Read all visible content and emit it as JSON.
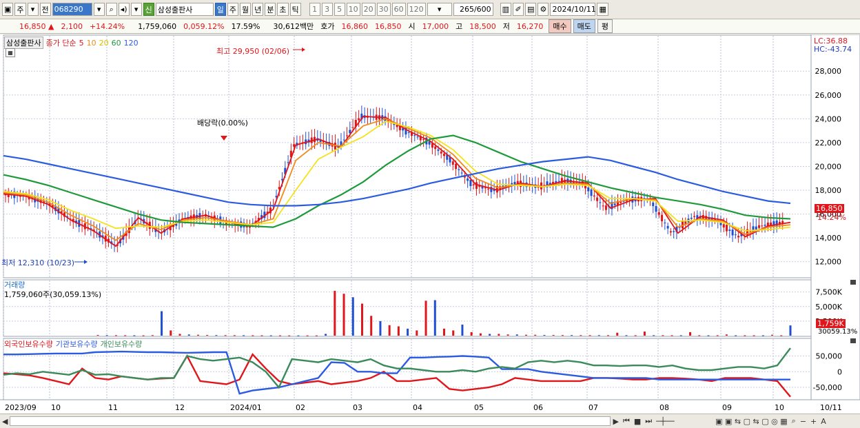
{
  "toolbar": {
    "mode": "주",
    "prev_label": "전",
    "code": "068290",
    "shin_label": "신",
    "stock_name": "삼성출판사",
    "periods": [
      "일",
      "주",
      "월",
      "년",
      "분",
      "초",
      "틱"
    ],
    "selected_period": "일",
    "intervals": [
      "1",
      "3",
      "5",
      "10",
      "20",
      "30",
      "60",
      "120"
    ],
    "count": "265/600",
    "date": "2024/10/11"
  },
  "quote": {
    "price": "16,850",
    "change": "2,100",
    "change_pct": "+14.24%",
    "volume": "1,759,060",
    "volume_pct": "0,059.12%",
    "turnover": "17.59%",
    "amount": "30,612백만",
    "hoga_label": "호가",
    "ask": "16,860",
    "bid": "16,850",
    "open_label": "시",
    "open": "17,000",
    "high_label": "고",
    "high": "18,500",
    "low_label": "저",
    "low": "16,270",
    "buy_label": "매수",
    "sell_label": "매도",
    "flat_label": "평"
  },
  "price_panel": {
    "name_tag": "삼성출판사",
    "legend_prefix": "종가 단순",
    "ma_labels": [
      "5",
      "10",
      "20",
      "60",
      "120"
    ],
    "lc_label": "LC:36.88",
    "hc_label": "HC:-43.74",
    "current_price_tag": "16,850",
    "current_pct_tag": "14.24%",
    "high_annotation": "최고 29,950 (02/06)",
    "low_annotation": "최저 12,310 (10/23)",
    "dividend_annotation": "배당락(0.00%)"
  },
  "volume_panel": {
    "title": "거래량",
    "summary": "1,759,060주(30,059.13%)",
    "current_tag": "1,759K",
    "current_pct_tag": "30059.13%"
  },
  "holdings_panel": {
    "legend": [
      "외국인보유수량",
      "기관보유수량",
      "개인보유수량"
    ]
  },
  "x_axis_labels": [
    "2023/09",
    "10",
    "11",
    "12",
    "2024/01",
    "02",
    "03",
    "04",
    "05",
    "06",
    "07",
    "08",
    "09",
    "10",
    "10/11"
  ],
  "colors": {
    "up": "#e0161b",
    "down": "#1f4fd0",
    "ma5": "#e0161b",
    "ma10": "#f08a1c",
    "ma20": "#f4e21c",
    "ma60": "#1e9a3a",
    "ma120": "#2b5be0",
    "foreign": "#e0161b",
    "institution": "#2b5be0",
    "individual": "#3a8a5a"
  },
  "chart_data": [
    {
      "type": "line",
      "title": "",
      "ylim": [
        11000,
        30500
      ],
      "y_ticks": [
        12000,
        14000,
        16000,
        18000,
        20000,
        22000,
        24000,
        26000,
        28000
      ],
      "y_tick_labels": [
        "12,000",
        "14,000",
        "16,000",
        "18,000",
        "20,000",
        "22,000",
        "24,000",
        "26,000",
        "28,000"
      ],
      "x_months": [
        "2023/09",
        "10",
        "11",
        "12",
        "2024/01",
        "02",
        "03",
        "04",
        "05",
        "06",
        "07",
        "08",
        "09",
        "10",
        "10/11"
      ],
      "series": [
        {
          "name": "5",
          "values": [
            17700,
            17500,
            16800,
            15500,
            14600,
            13300,
            15700,
            14400,
            15600,
            15900,
            15300,
            15000,
            16400,
            21800,
            22300,
            21600,
            24200,
            24100,
            23000,
            22100,
            20600,
            18500,
            18000,
            18600,
            18300,
            18800,
            18600,
            16500,
            17200,
            17300,
            14400,
            15800,
            15500,
            14100,
            15000,
            15300
          ]
        },
        {
          "name": "10",
          "values": [
            17800,
            17600,
            17000,
            15900,
            15000,
            13800,
            15200,
            14700,
            15500,
            15700,
            15400,
            15100,
            15600,
            20500,
            22000,
            21700,
            23400,
            24000,
            23200,
            22400,
            21000,
            19000,
            18200,
            18500,
            18300,
            18600,
            18500,
            16900,
            17300,
            17200,
            14900,
            15600,
            15400,
            14300,
            14900,
            15100
          ]
        },
        {
          "name": "20",
          "values": [
            17900,
            17700,
            17200,
            16300,
            15600,
            14800,
            15000,
            14900,
            15400,
            15500,
            15300,
            15100,
            15300,
            18000,
            20600,
            21600,
            22500,
            23800,
            23300,
            22600,
            21400,
            19600,
            18500,
            18400,
            18300,
            18500,
            18400,
            17300,
            17300,
            17100,
            15400,
            15500,
            15300,
            14600,
            14700,
            14900
          ]
        },
        {
          "name": "60",
          "values": [
            19300,
            18900,
            18400,
            17800,
            17200,
            16600,
            16000,
            15500,
            15300,
            15200,
            15100,
            15000,
            14900,
            15600,
            16700,
            17600,
            18700,
            20100,
            21300,
            22300,
            22600,
            22000,
            21200,
            20400,
            19800,
            19200,
            18700,
            18200,
            17800,
            17400,
            17100,
            16800,
            16400,
            15900,
            15700,
            15600
          ]
        },
        {
          "name": "120",
          "values": [
            20900,
            20600,
            20200,
            19800,
            19400,
            19000,
            18600,
            18200,
            17800,
            17400,
            17000,
            16800,
            16700,
            16700,
            16800,
            17000,
            17300,
            17700,
            18100,
            18600,
            19000,
            19400,
            19800,
            20100,
            20400,
            20600,
            20800,
            20500,
            20000,
            19500,
            18900,
            18400,
            17900,
            17500,
            17100,
            16900
          ]
        }
      ]
    },
    {
      "type": "bar",
      "title": "거래량",
      "ylim": [
        0,
        9000000
      ],
      "y_ticks": [
        2500000,
        5000000,
        7500000
      ],
      "y_tick_labels": [
        "2,500K",
        "5,000K",
        "7,500K"
      ],
      "values_note": "",
      "values": [
        120000,
        90000,
        80000,
        70000,
        60000,
        50000,
        90000,
        4200000,
        900000,
        300000,
        200000,
        150000,
        120000,
        100000,
        90000,
        80000,
        70000,
        60000,
        60000,
        50000,
        50000,
        40000,
        40000,
        40000,
        40000,
        300000,
        7700000,
        7200000,
        6600000,
        5500000,
        3400000,
        2500000,
        1800000,
        1600000,
        1200000,
        900000,
        6000000,
        6100000,
        1200000,
        900000,
        1900000,
        600000,
        400000,
        300000,
        300000,
        200000,
        200000,
        150000,
        150000,
        120000,
        120000,
        100000,
        100000,
        90000,
        90000,
        90000,
        80000,
        500000,
        80000,
        70000,
        700000,
        80000,
        80000,
        70000,
        70000,
        600000,
        70000,
        60000,
        70000,
        200000,
        60000,
        60000,
        60000,
        60000,
        150000,
        60000,
        1759060
      ]
    },
    {
      "type": "line",
      "title": "",
      "ylim": [
        -85000,
        95000
      ],
      "y_ticks": [
        50000,
        0,
        -50000
      ],
      "y_tick_labels": [
        "50,000",
        "0",
        "-50,000"
      ],
      "series": [
        {
          "name": "외국인보유수량",
          "values": [
            -5000,
            -8000,
            -12000,
            -20000,
            -30000,
            -40000,
            10000,
            -20000,
            -25000,
            -15000,
            -20000,
            -25000,
            -22000,
            -20000,
            50000,
            -30000,
            -35000,
            -40000,
            -25000,
            55000,
            10000,
            -30000,
            -40000,
            -35000,
            -30000,
            -40000,
            -35000,
            -30000,
            -20000,
            0,
            -30000,
            -30000,
            -25000,
            -20000,
            -55000,
            -60000,
            -55000,
            -50000,
            -40000,
            -20000,
            -25000,
            -30000,
            -30000,
            -30000,
            -30000,
            -20000,
            -20000,
            -22000,
            -25000,
            -25000,
            -20000,
            -20000,
            -22000,
            -25000,
            -30000,
            -20000,
            -20000,
            -20000,
            -25000,
            -30000,
            -80000
          ]
        },
        {
          "name": "기관보유수량",
          "values": [
            55000,
            55000,
            56000,
            57000,
            58000,
            58000,
            58000,
            62000,
            63000,
            64000,
            63000,
            62000,
            62000,
            61000,
            60000,
            61000,
            62000,
            62000,
            -70000,
            -60000,
            -55000,
            -50000,
            -40000,
            -30000,
            -20000,
            30000,
            28000,
            0,
            0,
            -5000,
            -5000,
            45000,
            45000,
            47000,
            48000,
            50000,
            48000,
            45000,
            8000,
            8000,
            8000,
            0,
            -5000,
            -10000,
            -15000,
            -20000,
            -20000,
            -20000,
            -20000,
            -20000,
            -25000,
            -25000,
            -25000,
            -25000,
            -25000,
            -25000,
            -25000,
            -25000,
            -25000,
            -25000,
            -25000
          ]
        },
        {
          "name": "개인보유수량",
          "values": [
            -10000,
            -5000,
            -8000,
            0,
            -5000,
            -10000,
            5000,
            -10000,
            -8000,
            -15000,
            -20000,
            -25000,
            -20000,
            -20000,
            50000,
            40000,
            35000,
            40000,
            45000,
            30000,
            0,
            -50000,
            40000,
            35000,
            30000,
            40000,
            35000,
            30000,
            40000,
            20000,
            10000,
            10000,
            5000,
            0,
            0,
            5000,
            0,
            10000,
            15000,
            10000,
            30000,
            35000,
            30000,
            35000,
            30000,
            20000,
            20000,
            18000,
            20000,
            20000,
            15000,
            20000,
            10000,
            5000,
            5000,
            10000,
            15000,
            15000,
            10000,
            20000,
            75000
          ]
        }
      ]
    }
  ]
}
